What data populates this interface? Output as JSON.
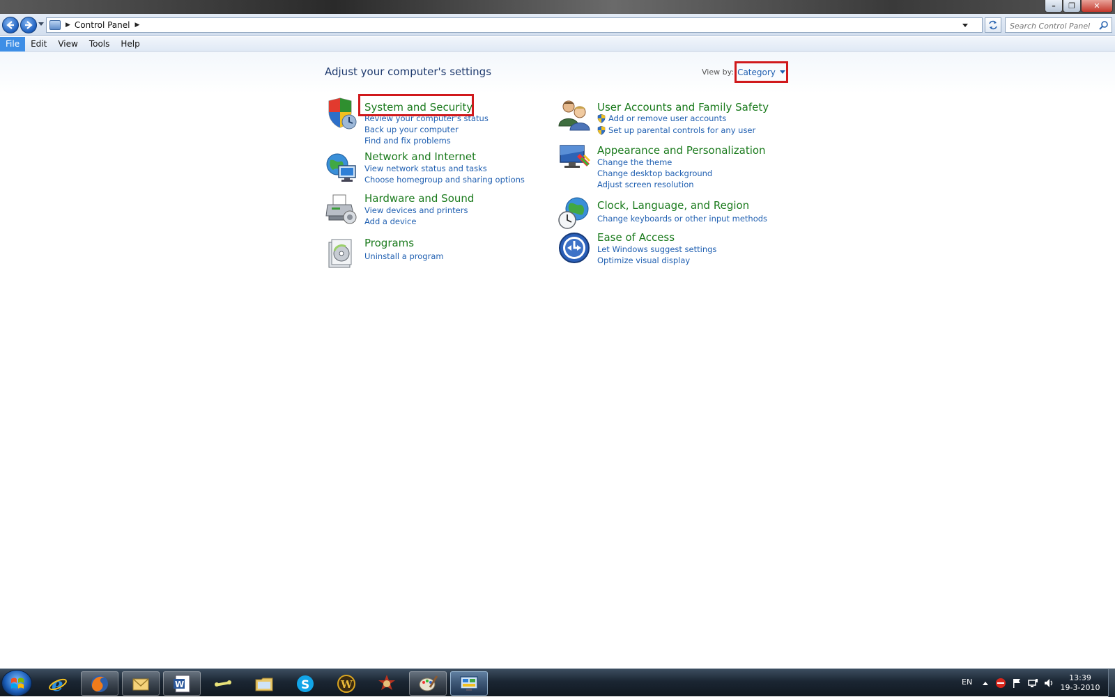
{
  "window": {
    "minimize_label": "–",
    "maximize_label": "❐",
    "close_label": "✕"
  },
  "address_bar": {
    "breadcrumb": "Control Panel",
    "search_placeholder": "Search Control Panel"
  },
  "menu": [
    "File",
    "Edit",
    "View",
    "Tools",
    "Help"
  ],
  "content": {
    "heading": "Adjust your computer's settings",
    "view_by_label": "View by:",
    "view_by_value": "Category"
  },
  "categories": {
    "system_security": {
      "title": "System and Security",
      "links": [
        "Review your computer's status",
        "Back up your computer",
        "Find and fix problems"
      ]
    },
    "network_internet": {
      "title": "Network and Internet",
      "links": [
        "View network status and tasks",
        "Choose homegroup and sharing options"
      ]
    },
    "hardware_sound": {
      "title": "Hardware and Sound",
      "links": [
        "View devices and printers",
        "Add a device"
      ]
    },
    "programs": {
      "title": "Programs",
      "links": [
        "Uninstall a program"
      ]
    },
    "user_accounts": {
      "title": "User Accounts and Family Safety",
      "links": [
        "Add or remove user accounts",
        "Set up parental controls for any user"
      ]
    },
    "appearance": {
      "title": "Appearance and Personalization",
      "links": [
        "Change the theme",
        "Change desktop background",
        "Adjust screen resolution"
      ]
    },
    "clock_region": {
      "title": "Clock, Language, and Region",
      "links": [
        "Change keyboards or other input methods"
      ]
    },
    "ease_access": {
      "title": "Ease of Access",
      "links": [
        "Let Windows suggest settings",
        "Optimize visual display"
      ]
    }
  },
  "taskbar": {
    "apps": [
      "internet-explorer-icon",
      "firefox-icon",
      "mail-icon",
      "word-icon",
      "tool-icon",
      "explorer-folder-icon",
      "skype-icon",
      "warcraft-icon",
      "game-icon",
      "paint-icon",
      "control-panel-icon"
    ],
    "language": "EN",
    "time": "13:39",
    "date": "19-3-2010"
  },
  "colors": {
    "category_title": "#1a7a1c",
    "link": "#1f5fb1",
    "highlight": "#d0191c"
  }
}
